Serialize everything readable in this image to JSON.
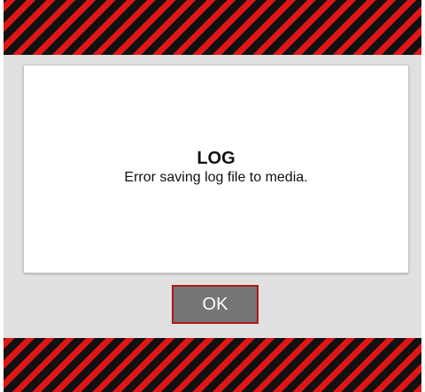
{
  "dialog": {
    "title": "LOG",
    "message": "Error saving log file to media.",
    "ok_label": "OK"
  },
  "colors": {
    "stripe_red": "#e01616",
    "stripe_black": "#111111",
    "background_gray": "#e0e0e0",
    "button_gray": "#757575",
    "button_border": "#b01818"
  }
}
